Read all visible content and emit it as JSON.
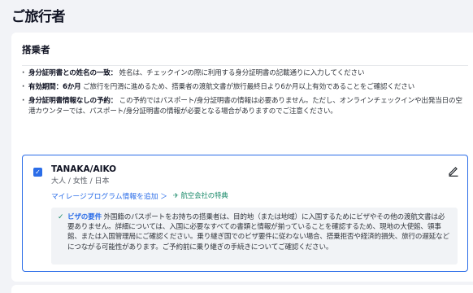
{
  "page": {
    "title": "ご旅行者"
  },
  "section": {
    "title": "搭乗者"
  },
  "notes": [
    {
      "label": "身分証明書との姓名の一致：",
      "text": "姓名は、チェックインの際に利用する身分証明書の記載通りに入力してください"
    },
    {
      "label": "有効期間：6か月",
      "text": "ご旅行を円滑に進めるため、搭乗者の渡航文書が旅行最終日より6か月以上有効であることをご確認ください"
    },
    {
      "label": "身分証明書情報なしの予約：",
      "text": "この予約ではパスポート/身分証明書の情報は必要ありません。ただし、オンラインチェックインや出発当日の空港カウンターでは、パスポート/身分証明書の情報が必要となる場合がありますのでご注意ください。"
    }
  ],
  "passenger": {
    "name": "TANAKA/AIKO",
    "meta": "大人 / 女性 / 日本",
    "mileage_link": "マイレージプログラム情報を追加 ＞",
    "perk": "航空会社の特典",
    "visa_title": "ビザの要件",
    "visa_text": "外国籍のパスポートをお持ちの搭乗者は、目的地（または地域）に入国するためにビザやその他の渡航文書は必要ありません。詳細については、入国に必要なすべての書類と情報が揃っていることを確認するため、現地の大使館、領事館、または入国管理局にご確認ください。乗り継ぎ国でのビザ要件に従わない場合、搭乗拒否や経済的損失、旅行の遅延などにつながる可能性があります。ご予約前に乗り継ぎの手続きについてご確認ください。"
  },
  "icons": {
    "checkbox": "checkbox-checked-icon",
    "edit": "pencil-icon",
    "check": "checkmark-icon",
    "perk": "perk-icon"
  },
  "colors": {
    "accent": "#2b6de8",
    "success": "#1a8a6a",
    "page_bg": "#f2f3f7"
  }
}
